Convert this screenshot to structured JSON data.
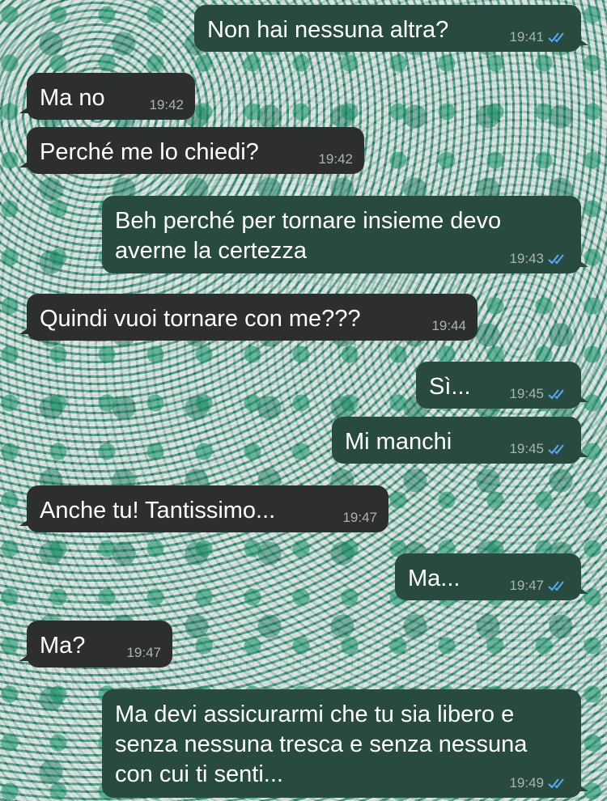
{
  "colors": {
    "incoming_bubble": "#2c2f2e",
    "outgoing_bubble": "#284a3f",
    "read_ticks": "#59a9f7"
  },
  "messages": [
    {
      "text": "Non hai nessuna altra?",
      "time": "19:41",
      "sender": "me",
      "status": "read"
    },
    {
      "text": "Ma no",
      "time": "19:42",
      "sender": "them"
    },
    {
      "text": "Perché me lo chiedi?",
      "time": "19:42",
      "sender": "them"
    },
    {
      "text": "Beh perché per tornare insieme devo averne la certezza",
      "time": "19:43",
      "sender": "me",
      "status": "read"
    },
    {
      "text": "Quindi vuoi tornare con me???",
      "time": "19:44",
      "sender": "them"
    },
    {
      "text": "Sì...",
      "time": "19:45",
      "sender": "me",
      "status": "read"
    },
    {
      "text": "Mi manchi",
      "time": "19:45",
      "sender": "me",
      "status": "read"
    },
    {
      "text": "Anche tu! Tantissimo...",
      "time": "19:47",
      "sender": "them"
    },
    {
      "text": "Ma...",
      "time": "19:47",
      "sender": "me",
      "status": "read"
    },
    {
      "text": "Ma?",
      "time": "19:47",
      "sender": "them"
    },
    {
      "text": "Ma devi assicurarmi che tu sia libero e senza nessuna tresca e senza nessuna con cui ti senti...",
      "time": "19:49",
      "sender": "me",
      "status": "read"
    }
  ]
}
